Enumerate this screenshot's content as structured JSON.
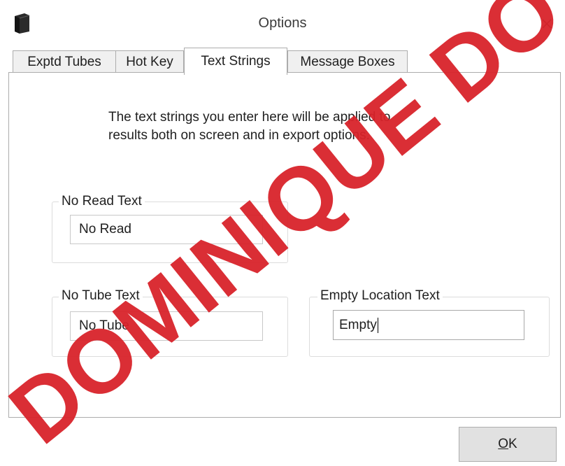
{
  "window": {
    "title": "Options",
    "icon": "book-icon"
  },
  "tabs": [
    {
      "label": "Exptd Tubes",
      "active": false
    },
    {
      "label": "Hot Key",
      "active": false
    },
    {
      "label": "Text Strings",
      "active": true
    },
    {
      "label": "Message Boxes",
      "active": false
    }
  ],
  "description": {
    "line1": "The text strings you enter here will be applied to",
    "line2": "results both on screen and in export options."
  },
  "fields": {
    "no_read": {
      "label": "No Read Text",
      "value": "No Read"
    },
    "no_tube": {
      "label": "No Tube Text",
      "value": "No Tube"
    },
    "empty_location": {
      "label": "Empty Location Text",
      "value": "Empty"
    }
  },
  "buttons": {
    "ok_label": "OK",
    "ok_accelerator": "O",
    "ok_rest": "K"
  },
  "watermark": {
    "text": "DOMINIQUE DO",
    "color": "#d8232a"
  }
}
